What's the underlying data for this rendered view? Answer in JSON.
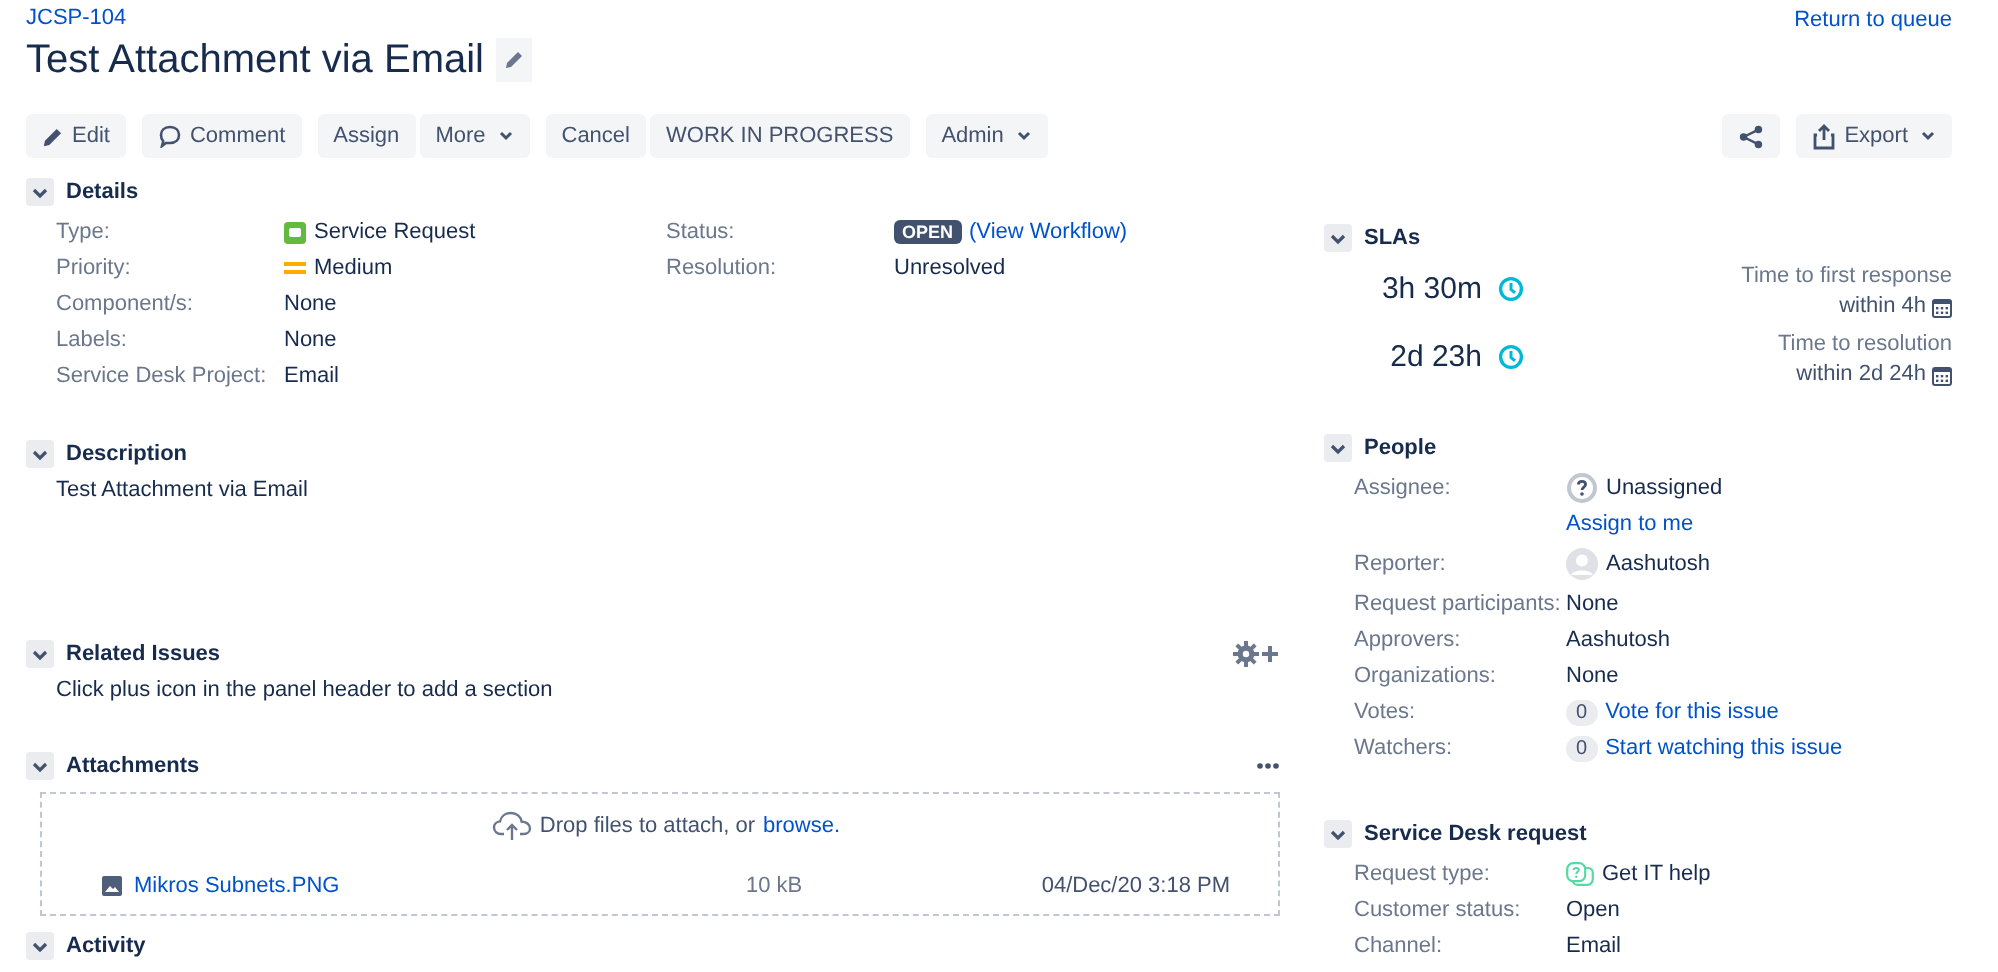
{
  "issue_key": "JCSP-104",
  "title": "Test Attachment via Email",
  "return_link": "Return to queue",
  "toolbar": {
    "groups": [
      [
        {
          "kind": "edit",
          "label": "Edit"
        }
      ],
      [
        {
          "kind": "comment",
          "label": "Comment"
        }
      ],
      [
        {
          "kind": "plain",
          "label": "Assign"
        },
        {
          "kind": "plain",
          "label": "More",
          "dropdown": true
        }
      ],
      [
        {
          "kind": "plain",
          "label": "Cancel"
        },
        {
          "kind": "plain",
          "label": "WORK IN PROGRESS"
        }
      ],
      [
        {
          "kind": "plain",
          "label": "Admin",
          "dropdown": true
        }
      ]
    ],
    "right": [
      [
        {
          "kind": "share"
        }
      ],
      [
        {
          "kind": "export",
          "label": "Export",
          "dropdown": true
        }
      ]
    ]
  },
  "details": {
    "heading": "Details",
    "expanded": true,
    "left": [
      {
        "label": "Type:",
        "kind": "type",
        "value": "Service Request"
      },
      {
        "label": "Priority:",
        "kind": "priority",
        "value": "Medium"
      },
      {
        "label": "Component/s:",
        "kind": "text",
        "value": "None"
      },
      {
        "label": "Labels:",
        "kind": "text",
        "value": "None"
      },
      {
        "label": "Service Desk Project:",
        "kind": "text",
        "value": "Email"
      }
    ],
    "right": [
      {
        "label": "Status:",
        "kind": "status",
        "value": "OPEN",
        "link": "(View Workflow)"
      },
      {
        "label": "Resolution:",
        "kind": "text",
        "value": "Unresolved"
      }
    ]
  },
  "description": {
    "heading": "Description",
    "expanded": true,
    "text": "Test Attachment via Email"
  },
  "related_issues": {
    "heading": "Related Issues",
    "expanded": true,
    "text": "Click plus icon in the panel header to add a section"
  },
  "attachments": {
    "heading": "Attachments",
    "expanded": true,
    "drop_text": "Drop files to attach, or",
    "browse": "browse.",
    "files": [
      {
        "name": "Mikros Subnets.PNG",
        "size": "10 kB",
        "date": "04/Dec/20 3:18 PM"
      }
    ]
  },
  "activity": {
    "heading": "Activity",
    "expanded": true
  },
  "slas": {
    "heading": "SLAs",
    "expanded": true,
    "items": [
      {
        "time": "3h 30m",
        "name": "Time to first response",
        "goal": "within 4h"
      },
      {
        "time": "2d 23h",
        "name": "Time to resolution",
        "goal": "within 2d 24h"
      }
    ]
  },
  "people": {
    "heading": "People",
    "expanded": true,
    "fields": [
      {
        "label": "Assignee:",
        "kind": "unassigned",
        "value": "Unassigned",
        "link": "Assign to me"
      },
      {
        "label": "Reporter:",
        "kind": "user",
        "value": "Aashutosh"
      },
      {
        "label": "Request participants:",
        "kind": "text",
        "value": "None"
      },
      {
        "label": "Approvers:",
        "kind": "text",
        "value": "Aashutosh"
      },
      {
        "label": "Organizations:",
        "kind": "text",
        "value": "None"
      },
      {
        "label": "Votes:",
        "kind": "count",
        "count": "0",
        "link": "Vote for this issue"
      },
      {
        "label": "Watchers:",
        "kind": "count",
        "count": "0",
        "link": "Start watching this issue"
      }
    ]
  },
  "service_desk": {
    "heading": "Service Desk request",
    "expanded": true,
    "fields": [
      {
        "label": "Request type:",
        "kind": "request",
        "value": "Get IT help"
      },
      {
        "label": "Customer status:",
        "kind": "text",
        "value": "Open"
      },
      {
        "label": "Channel:",
        "kind": "text",
        "value": "Email"
      }
    ]
  }
}
